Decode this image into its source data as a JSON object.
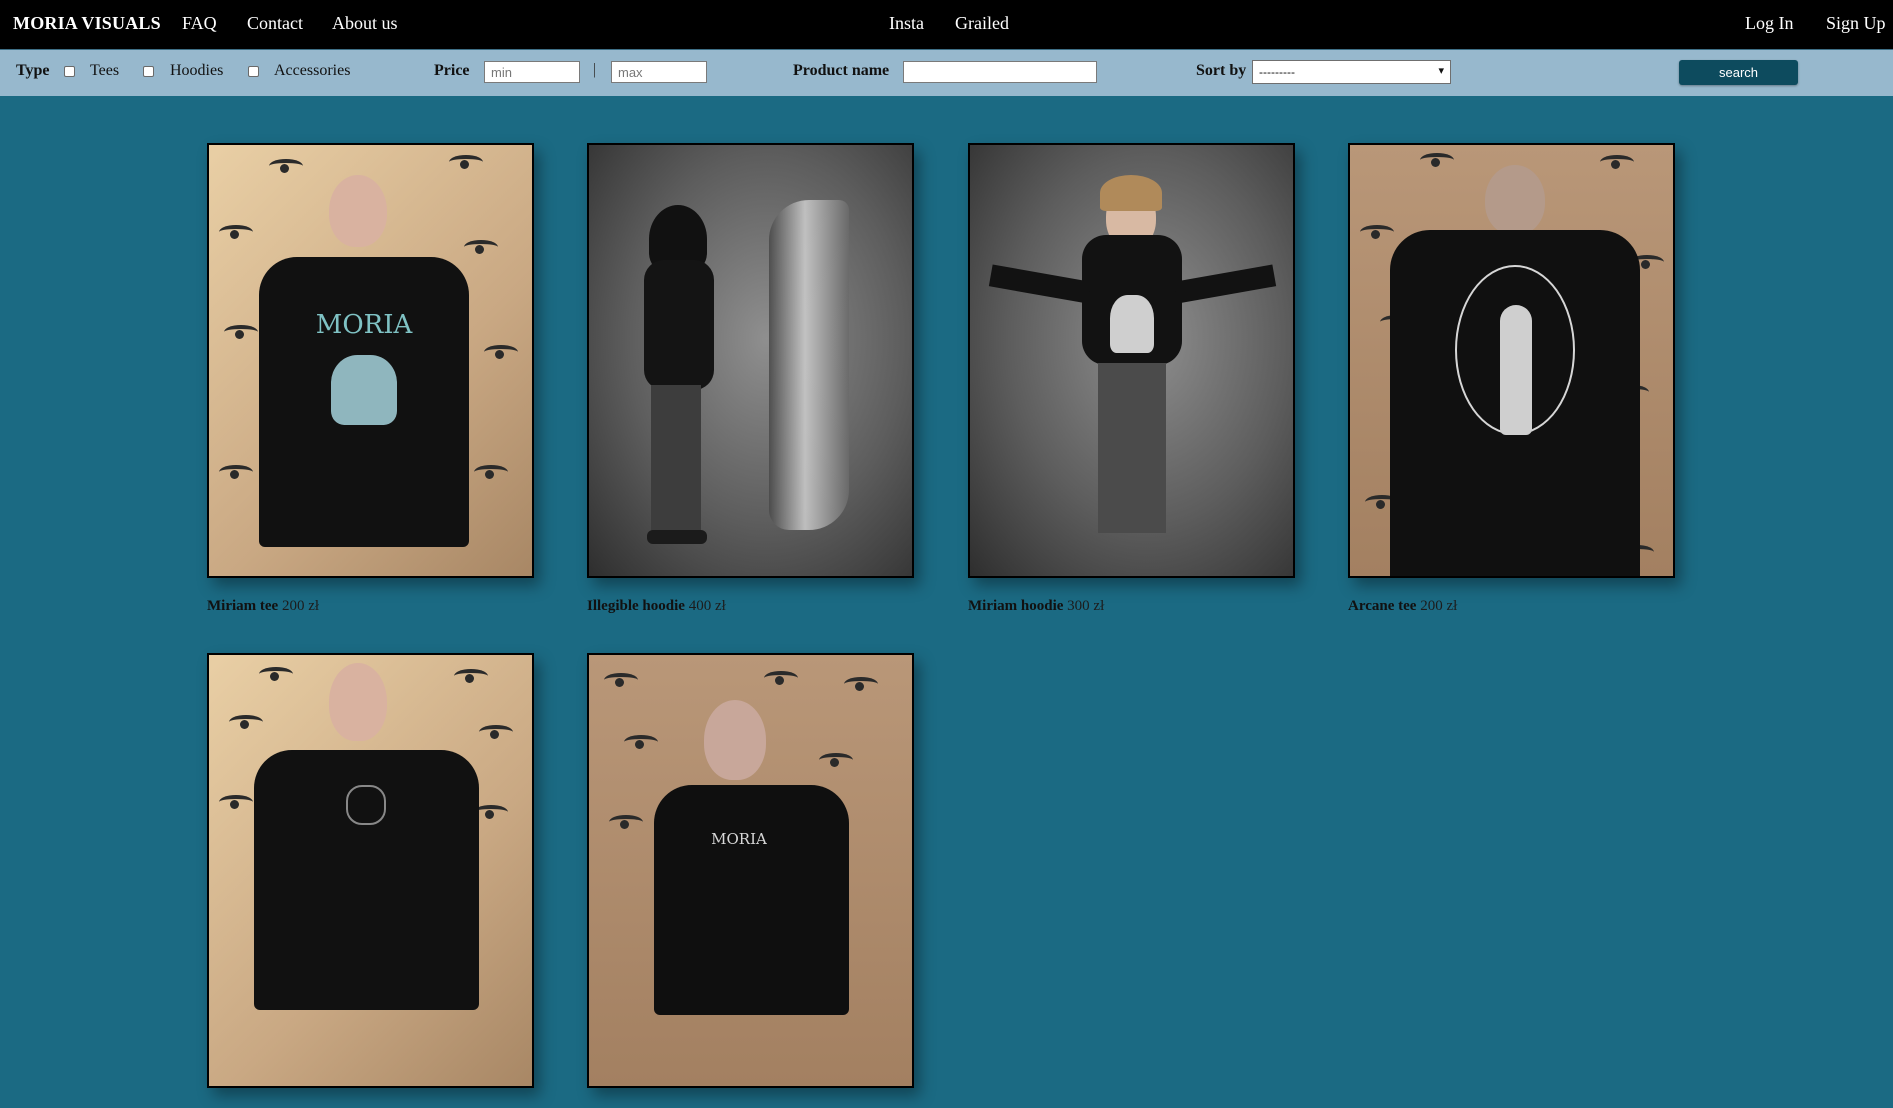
{
  "nav": {
    "brand": "MORIA VISUALS",
    "links": [
      "FAQ",
      "Contact",
      "About us"
    ],
    "social": [
      "Insta",
      "Grailed"
    ],
    "auth": [
      "Log In",
      "Sign Up"
    ]
  },
  "filters": {
    "type_label": "Type",
    "type_options": [
      "Tees",
      "Hoodies",
      "Accessories"
    ],
    "price_label": "Price",
    "price_min_placeholder": "min",
    "price_separator": "|",
    "price_max_placeholder": "max",
    "name_label": "Product name",
    "sort_label": "Sort by",
    "sort_selected": "---------",
    "search_button": "search"
  },
  "products": [
    {
      "name": "Miriam tee",
      "price": "200 zł"
    },
    {
      "name": "Illegible hoodie",
      "price": "400 zł"
    },
    {
      "name": "Miriam hoodie",
      "price": "300 zł"
    },
    {
      "name": "Arcane tee",
      "price": "200 zł"
    },
    {
      "name": "",
      "price": ""
    },
    {
      "name": "",
      "price": ""
    }
  ],
  "print_texts": {
    "moria": "MORIA"
  },
  "colors": {
    "background": "#1b6a83",
    "nav": "#000000",
    "filter_bar": "#97b8cd",
    "search_button": "#0d4b5e"
  }
}
